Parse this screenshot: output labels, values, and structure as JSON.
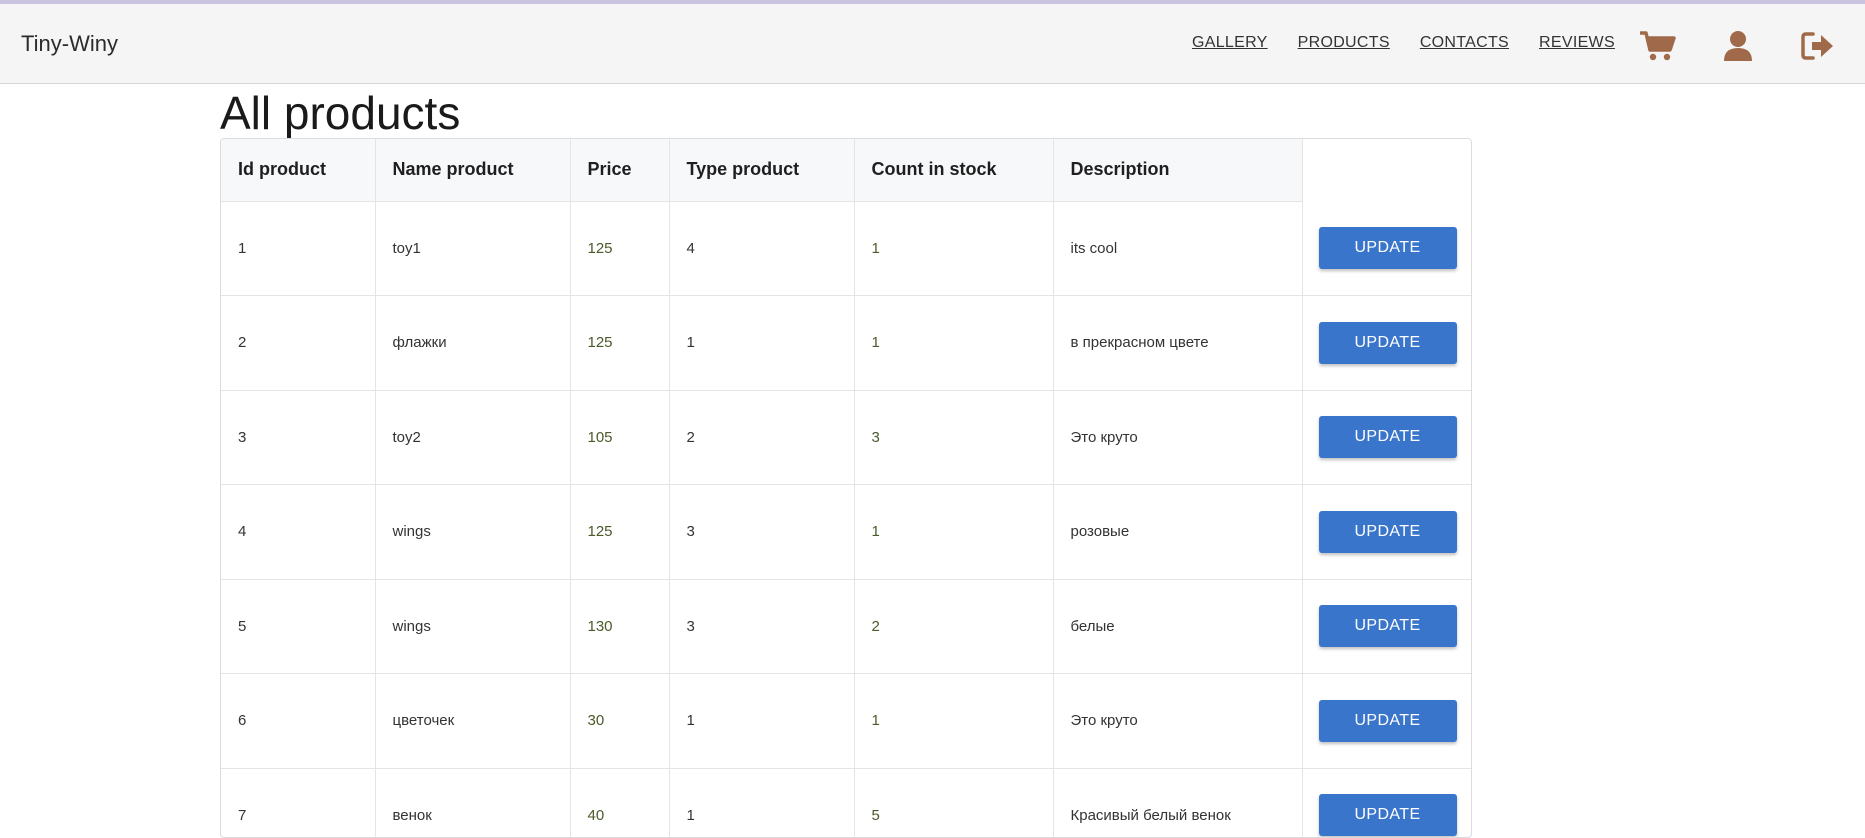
{
  "navbar": {
    "brand": "Tiny-Winy",
    "links": [
      "GALLERY",
      "PRODUCTS",
      "CONTACTS",
      "REVIEWS"
    ],
    "icons": [
      "cart-icon",
      "user-icon",
      "logout-icon"
    ],
    "icon_color": "#a0694a"
  },
  "page": {
    "title": "All products"
  },
  "table": {
    "columns": [
      "Id product",
      "Name product",
      "Price",
      "Type product",
      "Count in stock",
      "Description"
    ],
    "button_label": "UPDATE",
    "rows": [
      [
        "1",
        "toy1",
        "125",
        "4",
        "1",
        "its cool"
      ],
      [
        "2",
        "флажки",
        "125",
        "1",
        "1",
        "в прекрасном цвете"
      ],
      [
        "3",
        "toy2",
        "105",
        "2",
        "3",
        "Это круто"
      ],
      [
        "4",
        "wings",
        "125",
        "3",
        "1",
        "розовые"
      ],
      [
        "5",
        "wings",
        "130",
        "3",
        "2",
        "белые"
      ],
      [
        "6",
        "цветочек",
        "30",
        "1",
        "1",
        "Это круто"
      ],
      [
        "7",
        "венок",
        "40",
        "1",
        "5",
        "Красивый белый венок"
      ]
    ]
  },
  "colors": {
    "accent": "#3a75cc",
    "navbar_bg": "#f5f5f5",
    "top_strip": "#c9c3e0"
  }
}
